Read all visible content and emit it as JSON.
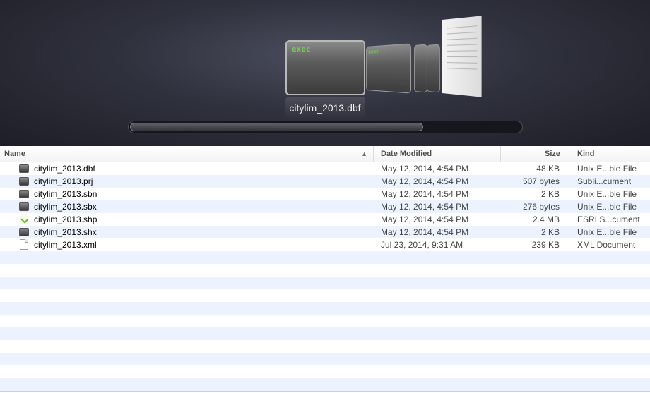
{
  "coverflow": {
    "selected_title": "citylim_2013.dbf",
    "exec_label": "exec",
    "scroll_position": 0.75
  },
  "columns": {
    "name": "Name",
    "date_modified": "Date Modified",
    "size": "Size",
    "kind": "Kind"
  },
  "files": [
    {
      "icon": "exec-icon",
      "name": "citylim_2013.dbf",
      "date": "May 12, 2014, 4:54 PM",
      "size": "48 KB",
      "kind": "Unix E...ble File"
    },
    {
      "icon": "exec-icon",
      "name": "citylim_2013.prj",
      "date": "May 12, 2014, 4:54 PM",
      "size": "507 bytes",
      "kind": "Subli...cument"
    },
    {
      "icon": "exec-icon",
      "name": "citylim_2013.sbn",
      "date": "May 12, 2014, 4:54 PM",
      "size": "2 KB",
      "kind": "Unix E...ble File"
    },
    {
      "icon": "exec-icon",
      "name": "citylim_2013.sbx",
      "date": "May 12, 2014, 4:54 PM",
      "size": "276 bytes",
      "kind": "Unix E...ble File"
    },
    {
      "icon": "shapefile-icon",
      "name": "citylim_2013.shp",
      "date": "May 12, 2014, 4:54 PM",
      "size": "2.4 MB",
      "kind": "ESRI S...cument"
    },
    {
      "icon": "exec-icon",
      "name": "citylim_2013.shx",
      "date": "May 12, 2014, 4:54 PM",
      "size": "2 KB",
      "kind": "Unix E...ble File"
    },
    {
      "icon": "document-icon",
      "name": "citylim_2013.xml",
      "date": "Jul 23, 2014, 9:31 AM",
      "size": "239 KB",
      "kind": "XML Document"
    }
  ]
}
